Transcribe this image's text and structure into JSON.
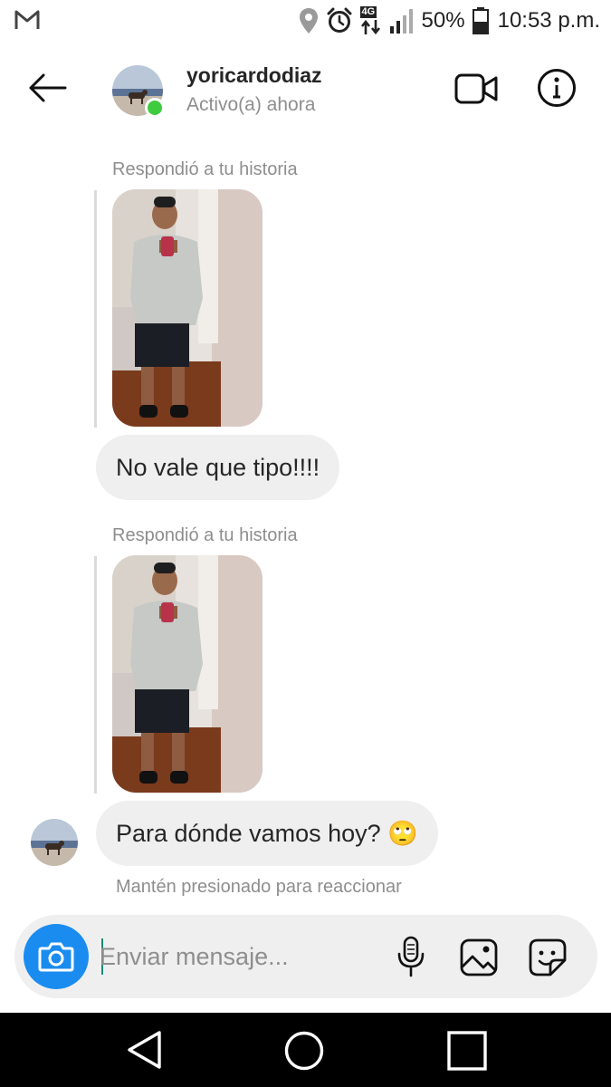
{
  "status_bar": {
    "battery_percent": "50%",
    "time": "10:53 p.m.",
    "network": "4G",
    "icons": [
      "gmail-icon",
      "location-icon",
      "alarm-icon",
      "network-4g-icon",
      "signal-icon",
      "battery-icon"
    ]
  },
  "header": {
    "username": "yoricardodiaz",
    "activity": "Activo(a) ahora",
    "online_color": "#3ecb3e",
    "icons": [
      "back-arrow-icon",
      "video-call-icon",
      "info-icon"
    ]
  },
  "chat": {
    "messages": [
      {
        "reply_label": "Respondió a tu historia",
        "text": "No vale que tipo!!!!"
      },
      {
        "reply_label": "Respondió a tu historia",
        "text": "Para dónde vamos hoy? 🙄"
      }
    ],
    "hint": "Mantén presionado para reaccionar"
  },
  "composer": {
    "placeholder": "Enviar mensaje...",
    "camera_color": "#1a8cf0",
    "icons": [
      "camera-icon",
      "microphone-icon",
      "gallery-icon",
      "sticker-icon"
    ]
  },
  "nav_bar": {
    "icons": [
      "nav-back-icon",
      "nav-home-icon",
      "nav-recents-icon"
    ]
  }
}
